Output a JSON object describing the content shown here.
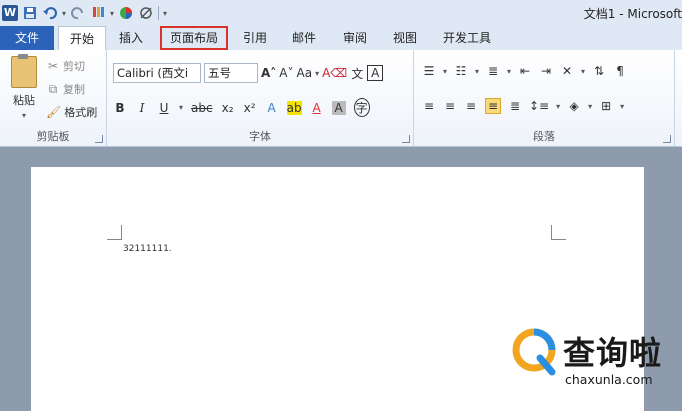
{
  "window": {
    "title": "文档1 - Microsoft"
  },
  "tabs": [
    "文件",
    "开始",
    "插入",
    "页面布局",
    "引用",
    "邮件",
    "审阅",
    "视图",
    "开发工具"
  ],
  "clipboard": {
    "paste": "粘贴",
    "cut": "剪切",
    "copy": "复制",
    "format_painter": "格式刷",
    "group_label": "剪贴板"
  },
  "font": {
    "name": "Calibri (西文i",
    "size": "五号",
    "case_btn": "Aa",
    "group_label": "字体"
  },
  "paragraph": {
    "group_label": "段落"
  },
  "document": {
    "text": "32111111."
  },
  "watermark": {
    "brand": "查询啦",
    "url": "chaxunla.com"
  },
  "colors": {
    "file_tab": "#2a63b9",
    "highlight_box": "#d9342b",
    "font_color": "#e0322c",
    "highlight_color": "#f2e600"
  }
}
